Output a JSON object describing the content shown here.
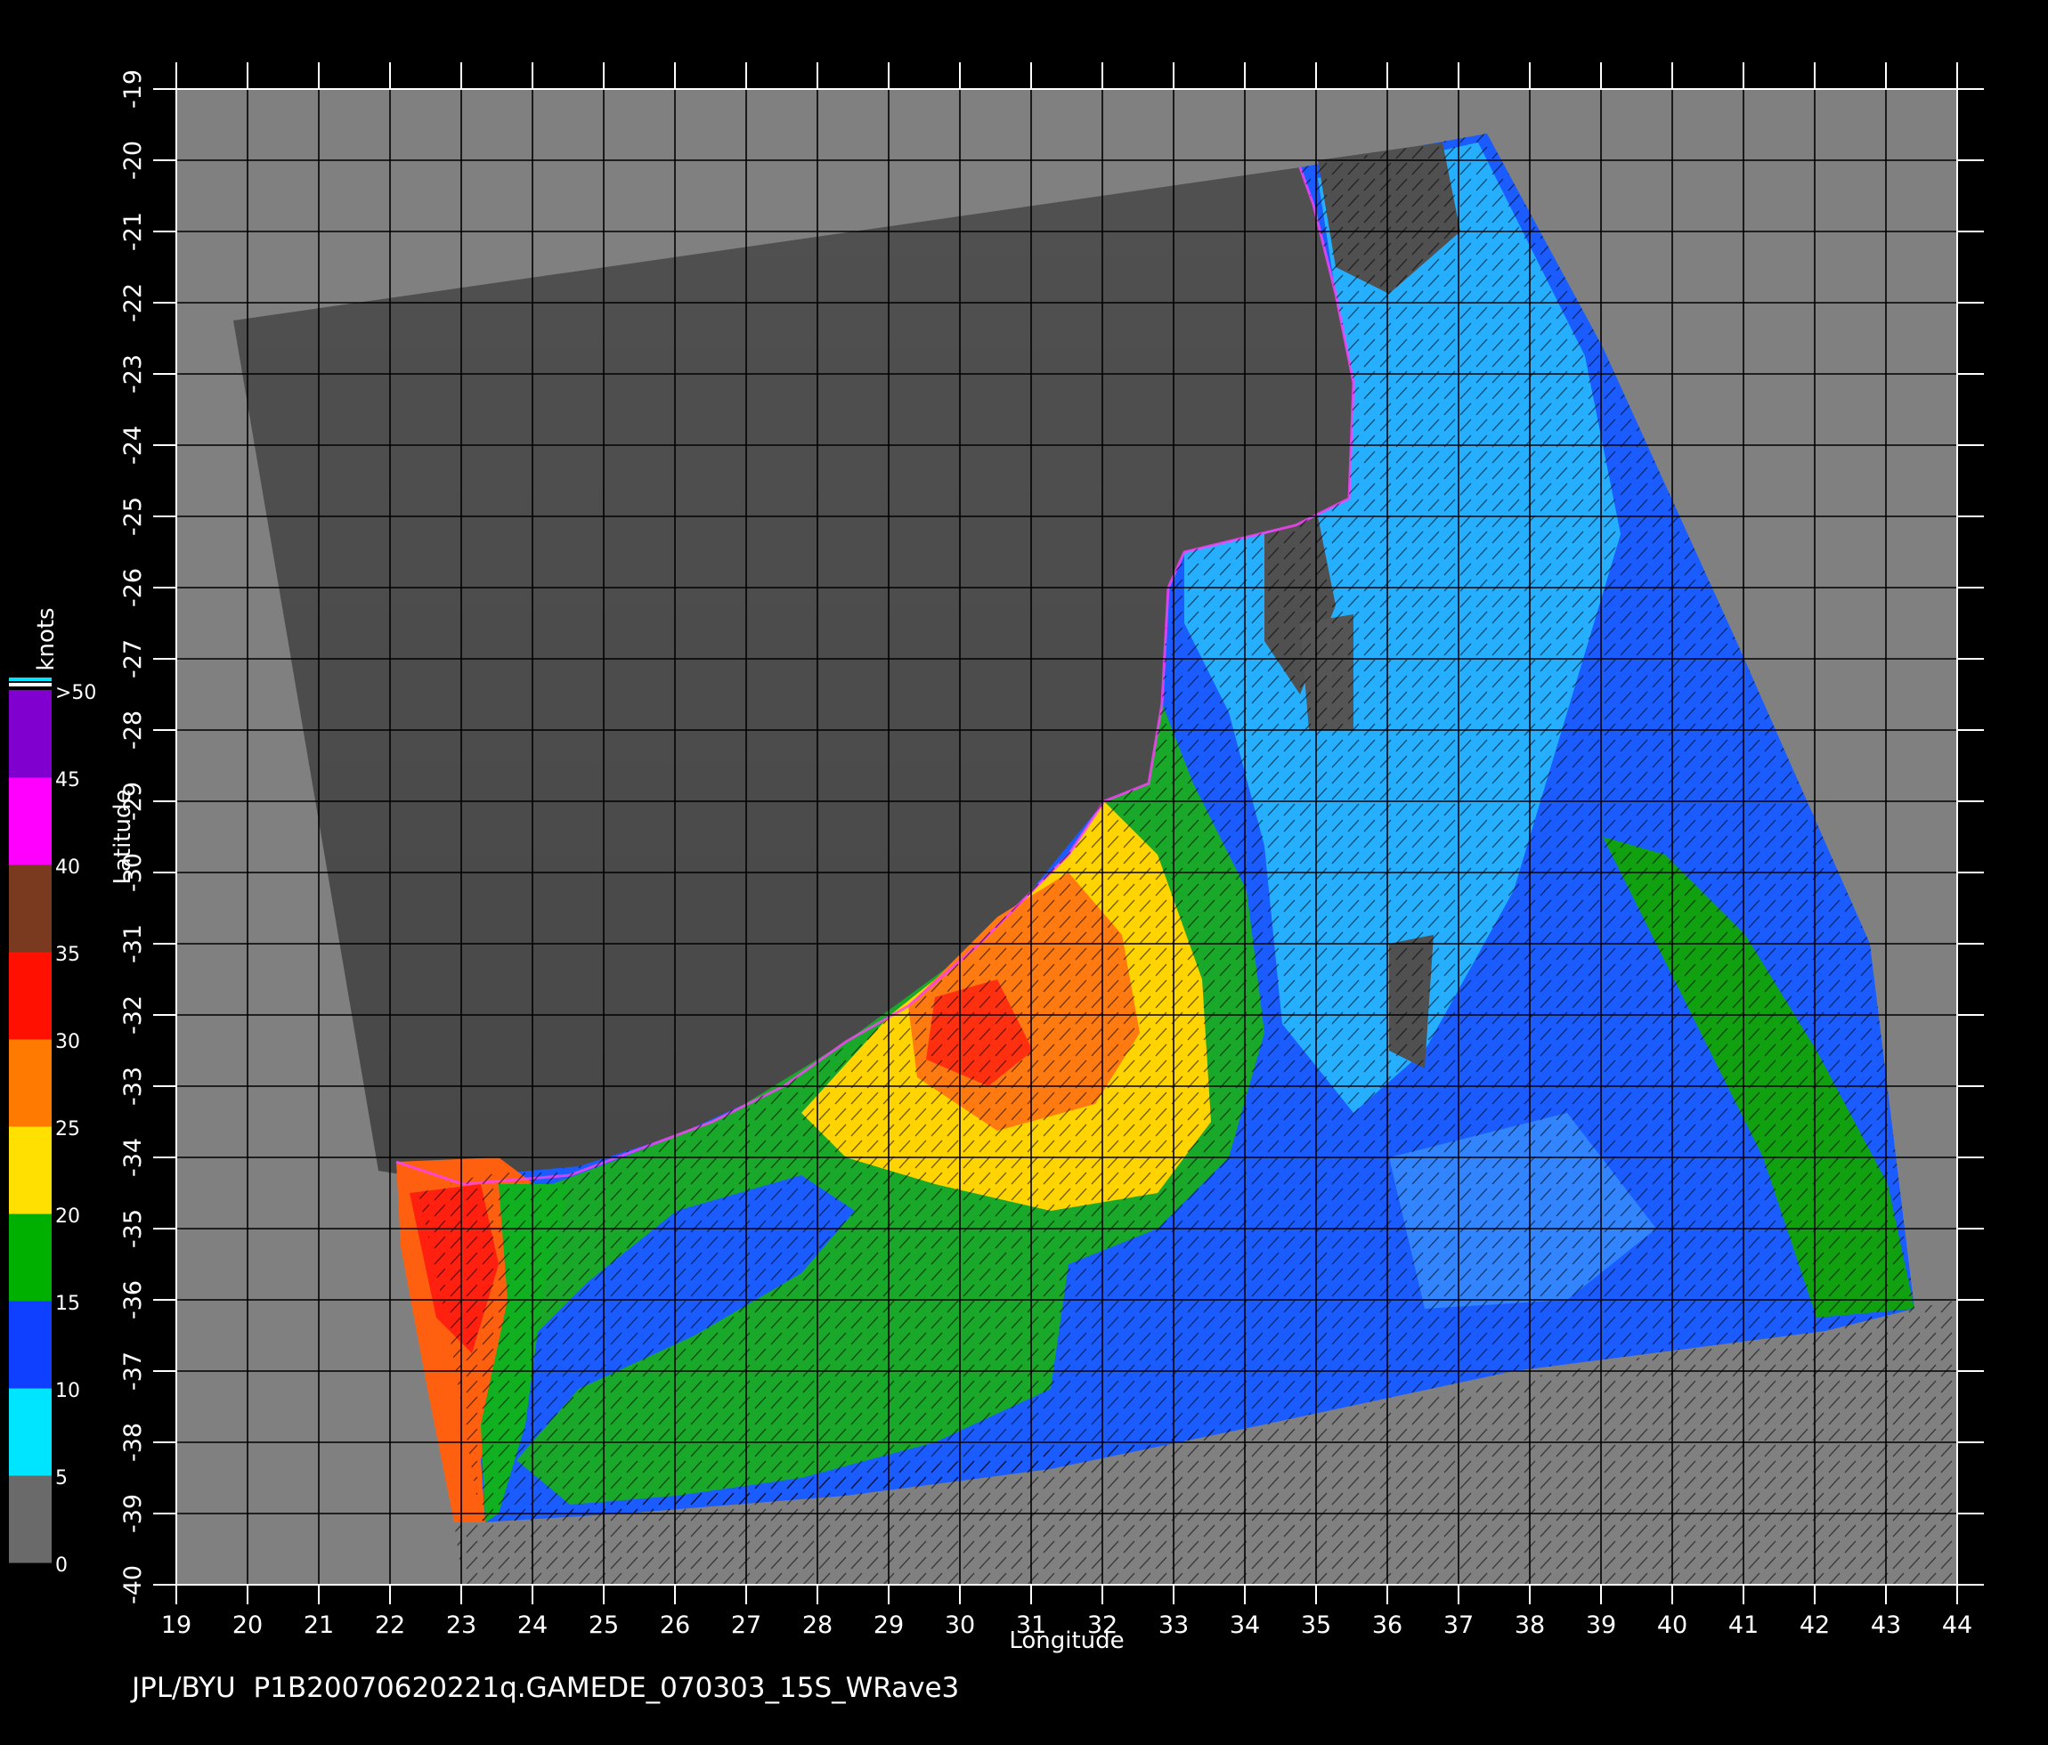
{
  "source_label": "JPL/BYU",
  "product_label": "P1B20070620221q.GAMEDE_070303_15S_WRave3",
  "axes": {
    "xlabel": "Longitude",
    "ylabel": "Latitude",
    "lon_ticks": [
      "19",
      "20",
      "21",
      "22",
      "23",
      "24",
      "25",
      "26",
      "27",
      "28",
      "29",
      "30",
      "31",
      "32",
      "33",
      "34",
      "35",
      "36",
      "37",
      "38",
      "39",
      "40",
      "41",
      "42",
      "43",
      "44"
    ],
    "lat_ticks": [
      "-19",
      "-20",
      "-21",
      "-22",
      "-23",
      "-24",
      "-25",
      "-26",
      "-27",
      "-28",
      "-29",
      "-30",
      "-31",
      "-32",
      "-33",
      "-34",
      "-35",
      "-36",
      "-37",
      "-38",
      "-39",
      "-40"
    ],
    "lon_range": [
      19,
      44
    ],
    "lat_range": [
      -19,
      -40
    ],
    "grid": "on"
  },
  "colorbar": {
    "unit_label": "knots",
    "tick_labels": [
      ">50",
      "45",
      "40",
      "35",
      "30",
      "25",
      "20",
      "15",
      "10",
      "5",
      "0"
    ],
    "bands": [
      {
        "range": "0-5",
        "color": "#6a6a6a"
      },
      {
        "range": "5-10",
        "color": "#00e5ff"
      },
      {
        "range": "10-15",
        "color": "#1040ff"
      },
      {
        "range": "15-20",
        "color": "#00b000"
      },
      {
        "range": "20-25",
        "color": "#ffe000"
      },
      {
        "range": "25-30",
        "color": "#ff7a00"
      },
      {
        "range": "30-35",
        "color": "#ff1000"
      },
      {
        "range": "35-40",
        "color": "#7a3a20"
      },
      {
        "range": "40-45",
        "color": "#ff00ff"
      },
      {
        "range": "45-50",
        "color": "#8000d0"
      }
    ]
  },
  "colors": {
    "background": "#000000",
    "map_outside": "#808080",
    "land": "#4d4d4d",
    "grid": "#000000"
  }
}
